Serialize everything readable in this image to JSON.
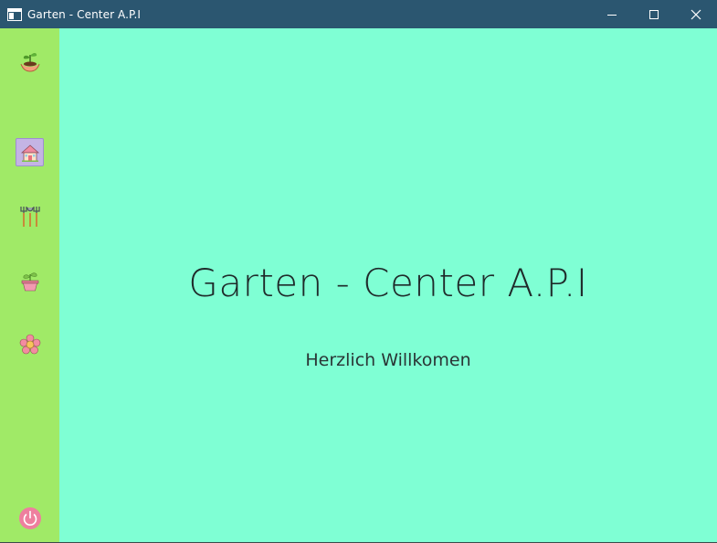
{
  "window": {
    "title": "Garten - Center A.P.I",
    "controls": [
      "minimize-icon",
      "maximize-icon",
      "close-icon"
    ]
  },
  "sidebar": {
    "items": [
      {
        "name": "logo",
        "icon": "plant-hands-icon"
      },
      {
        "name": "home",
        "icon": "house-icon",
        "active": true
      },
      {
        "name": "tools",
        "icon": "garden-tools-icon"
      },
      {
        "name": "plants",
        "icon": "potted-plant-icon"
      },
      {
        "name": "flowers",
        "icon": "flower-icon"
      },
      {
        "name": "power",
        "icon": "power-icon"
      }
    ]
  },
  "main": {
    "title": "Garten - Center A.P.I",
    "subtitle": "Herzlich Willkomen"
  },
  "colors": {
    "titlebar": "#2b5670",
    "sidebar": "#a0ea67",
    "background": "#7fffd4",
    "active_item": "#c4b4e4"
  }
}
